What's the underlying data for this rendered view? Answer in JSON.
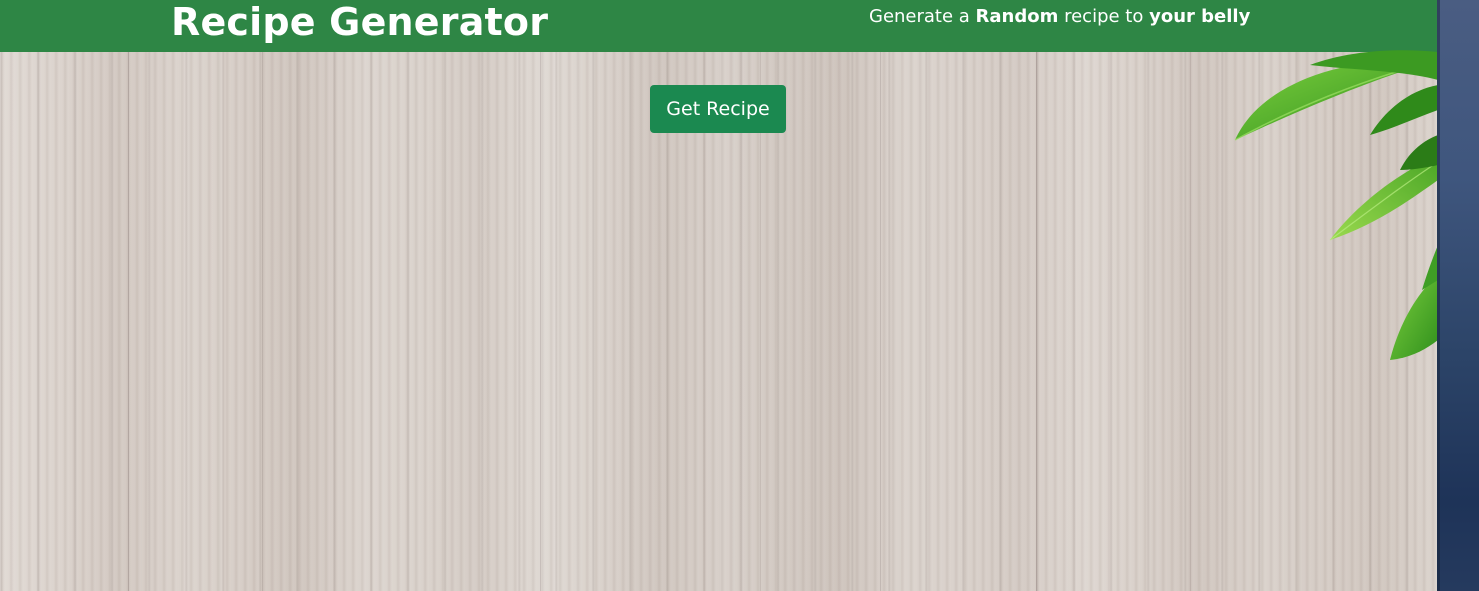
{
  "header": {
    "title": "Recipe Generator",
    "tagline": {
      "prefix": "Generate a ",
      "bold1": "Random",
      "middle": " recipe to ",
      "bold2": "your belly"
    }
  },
  "main": {
    "get_recipe_label": "Get Recipe"
  },
  "colors": {
    "header_bg": "#2e8645",
    "button_bg": "#1b8950",
    "text": "#ffffff"
  },
  "decorations": {
    "background": "wood-texture",
    "corner_art": "leaf-icon"
  }
}
